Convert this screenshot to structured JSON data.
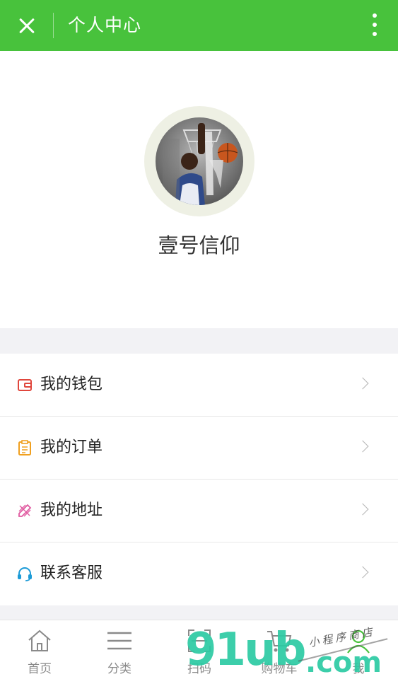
{
  "header": {
    "title": "个人中心",
    "close_icon": "close-icon",
    "more_icon": "more-vertical-icon",
    "background_color": "#48c23c"
  },
  "profile": {
    "username": "壹号信仰"
  },
  "menu": {
    "items": [
      {
        "label": "我的钱包",
        "icon": "wallet-icon",
        "color": "#e0463c"
      },
      {
        "label": "我的订单",
        "icon": "order-list-icon",
        "color": "#f0a020"
      },
      {
        "label": "我的地址",
        "icon": "address-edit-icon",
        "color": "#e05aa0"
      },
      {
        "label": "联系客服",
        "icon": "headset-icon",
        "color": "#1d9bd7"
      }
    ]
  },
  "tabbar": {
    "tabs": [
      {
        "label": "首页",
        "icon": "home-icon"
      },
      {
        "label": "分类",
        "icon": "category-list-icon"
      },
      {
        "label": "扫码",
        "icon": "scan-icon"
      },
      {
        "label": "购物车",
        "icon": "cart-icon"
      },
      {
        "label": "我",
        "icon": "user-icon",
        "active": true
      }
    ]
  },
  "watermark": {
    "brand": "91ub",
    "domain": ".com",
    "script": "小程序商店"
  }
}
